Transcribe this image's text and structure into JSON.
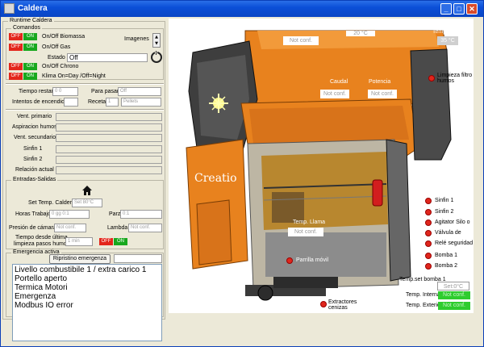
{
  "window": {
    "title": "Caldera"
  },
  "runtime_group": "Runtime Caldera",
  "comandos": {
    "caption": "Comandos",
    "off_label": "OFF",
    "on_label": "ON",
    "rows": [
      "On/Off Biomassa",
      "On/Off Gas",
      "On/Off Chrono",
      "Klima On=Day /Off=Night"
    ],
    "imagenes_label": "Imagenes",
    "estado_label": "Estado",
    "estado_value": "Off"
  },
  "tiempos": {
    "tiempo_restante_label": "Tiempo restante",
    "tiempo_restante_value": "0 0",
    "para_pasar_label": "Para pasar a",
    "para_pasar_value": "Off",
    "intentos_label": "Intentos de encendido",
    "receta_label": "Receta",
    "receta_value": "1",
    "receta_type": "Pellets"
  },
  "estados": [
    "Vent. primario",
    "Aspiracion humos",
    "Vent. secundario",
    "Sinfin 1",
    "Sinfin 2",
    "Relación actual"
  ],
  "entradas": {
    "caption": "Entradas-Salidas",
    "set_temp_label": "Set Temp. Caldera",
    "set_temp_value": "Set 80°C",
    "horas_label": "Horas Trabajo",
    "horas_value": "0 gg 0:1",
    "parz_label": "Parz",
    "parz_value": "0:1",
    "presion_label": "Presión de cámara",
    "presion_value": "Not conf.",
    "lambda_label": "Lambda",
    "lambda_value": "Not conf.",
    "tiempo_limpieza_label_1": "Tiempo desde última",
    "tiempo_limpieza_label_2": "limpieza pasos humos",
    "tiempo_limpieza_value": "1 min"
  },
  "emergencia": {
    "caption": "Emergencia activa",
    "reset_button": "Ripristino emergenza",
    "items": [
      "Livello combustibile 1 / extra carico 1",
      "Portello aperto",
      "Termica Motori",
      "Emergenza",
      "Modbus IO error"
    ]
  },
  "diagram": {
    "top_left_value": "Not conf.",
    "top_mid_value": "20 °C",
    "temp_humos_label": "Temp. Humos",
    "temp_humos_value": "35 °C",
    "limpieza_label": "Limpieza filtro humos",
    "caudal_label": "Caudal",
    "caudal_value": "Not conf.",
    "potencia_label": "Potencia",
    "potencia_value": "Not conf.",
    "brand": "Creatio",
    "temp_llama_label": "Temp. Llama",
    "temp_llama_value": "Not conf.",
    "parrilla_label": "Parrilla móvil",
    "extractores_label": "Extractores cenizas",
    "right_items": [
      "Sinfin 1",
      "Sinfin 2",
      "Agitator Silo o",
      "Válvula de",
      "Relé seguridad",
      "Bomba 1",
      "Bomba 2"
    ],
    "temp_set_bomba_label": "Temp.set bomba 1",
    "temp_set_bomba_value": "Set:0°C",
    "temp_interna_label": "Temp. Interna",
    "temp_interna_value": "Not conf.",
    "temp_exterior_label": "Temp. Exterior",
    "temp_exterior_value": "Not conf."
  },
  "colors": {
    "off_red": "#e3261b",
    "on_green": "#18a81e",
    "boiler_orange": "#e8821e",
    "boiler_dark": "#3a3a3a"
  }
}
